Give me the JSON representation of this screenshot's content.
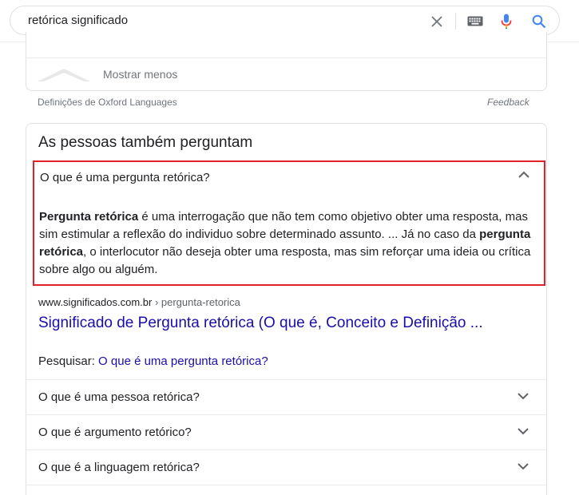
{
  "search": {
    "query": "retórica significado",
    "icons": [
      "close-icon",
      "keyboard-icon",
      "mic-icon",
      "search-icon"
    ]
  },
  "dictionary": {
    "show_less_label": "Mostrar menos",
    "source_label": "Definições de Oxford Languages",
    "feedback_label": "Feedback"
  },
  "paa": {
    "title": "As pessoas também perguntam",
    "expanded": {
      "question": "O que é uma pergunta retórica?",
      "answer_parts": {
        "b1": "Pergunta retórica",
        "t1": " é uma interrogação que não tem como objetivo obter uma resposta, mas sim estimular a reflexão do individuo sobre determinado assunto. ... Já no caso da ",
        "b2": "pergunta retórica",
        "t2": ", o interlocutor não deseja obter uma resposta, mas sim reforçar uma ideia ou crítica sobre algo ou alguém."
      },
      "source_domain": "www.significados.com.br",
      "source_crumb": " › pergunta-retorica",
      "source_title": "Significado de Pergunta retórica (O que é, Conceito e Definição ...",
      "search_for_label": "Pesquisar: ",
      "search_for_link": "O que é uma pergunta retórica?"
    },
    "questions": [
      "O que é uma pessoa retórica?",
      "O que é argumento retórico?",
      "O que é a linguagem retórica?"
    ]
  },
  "colors": {
    "link": "#1a0dab",
    "highlight_border": "#e0202a",
    "mic_blue": "#4285f4",
    "mic_red": "#ea4335"
  }
}
